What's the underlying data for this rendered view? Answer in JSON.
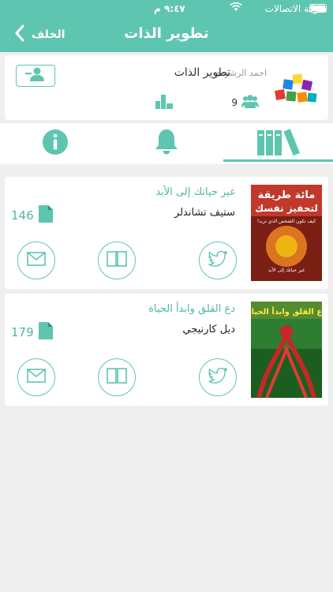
{
  "status": {
    "carrier": "شركة الاتصالات",
    "time": "٩:٤٧ م"
  },
  "nav": {
    "title": "تطوير الذات",
    "back_label": "الخلف"
  },
  "profile": {
    "group_name": "تطوير الذات",
    "owner_name": "احمد الرشودي",
    "members_count": "9"
  },
  "tabs": [
    {
      "name": "books",
      "icon": "books-icon",
      "active": true
    },
    {
      "name": "notifications",
      "icon": "bell-icon",
      "active": false
    },
    {
      "name": "info",
      "icon": "info-icon",
      "active": false
    }
  ],
  "books": [
    {
      "title": "غير حياتك إلى الأبد",
      "author": "ستيف تشاندلر",
      "pages": "146",
      "cover": {
        "headline": "مائة طريقة",
        "headline2": "لتحفيز نفسك",
        "tagline": "كيف تكون الشخص الذي تريد!",
        "subtitle": "غير حياتك إلى الأبد"
      }
    },
    {
      "title": "دع القلق وابدأ الحياة",
      "author": "ديل كارنيجي",
      "pages": "179",
      "cover": {
        "headline": "دع القلق وابدأ الحياة"
      }
    }
  ],
  "colors": {
    "accent": "#5ec5b1",
    "accent_text": "#4fb6a6",
    "background": "#efefef"
  }
}
